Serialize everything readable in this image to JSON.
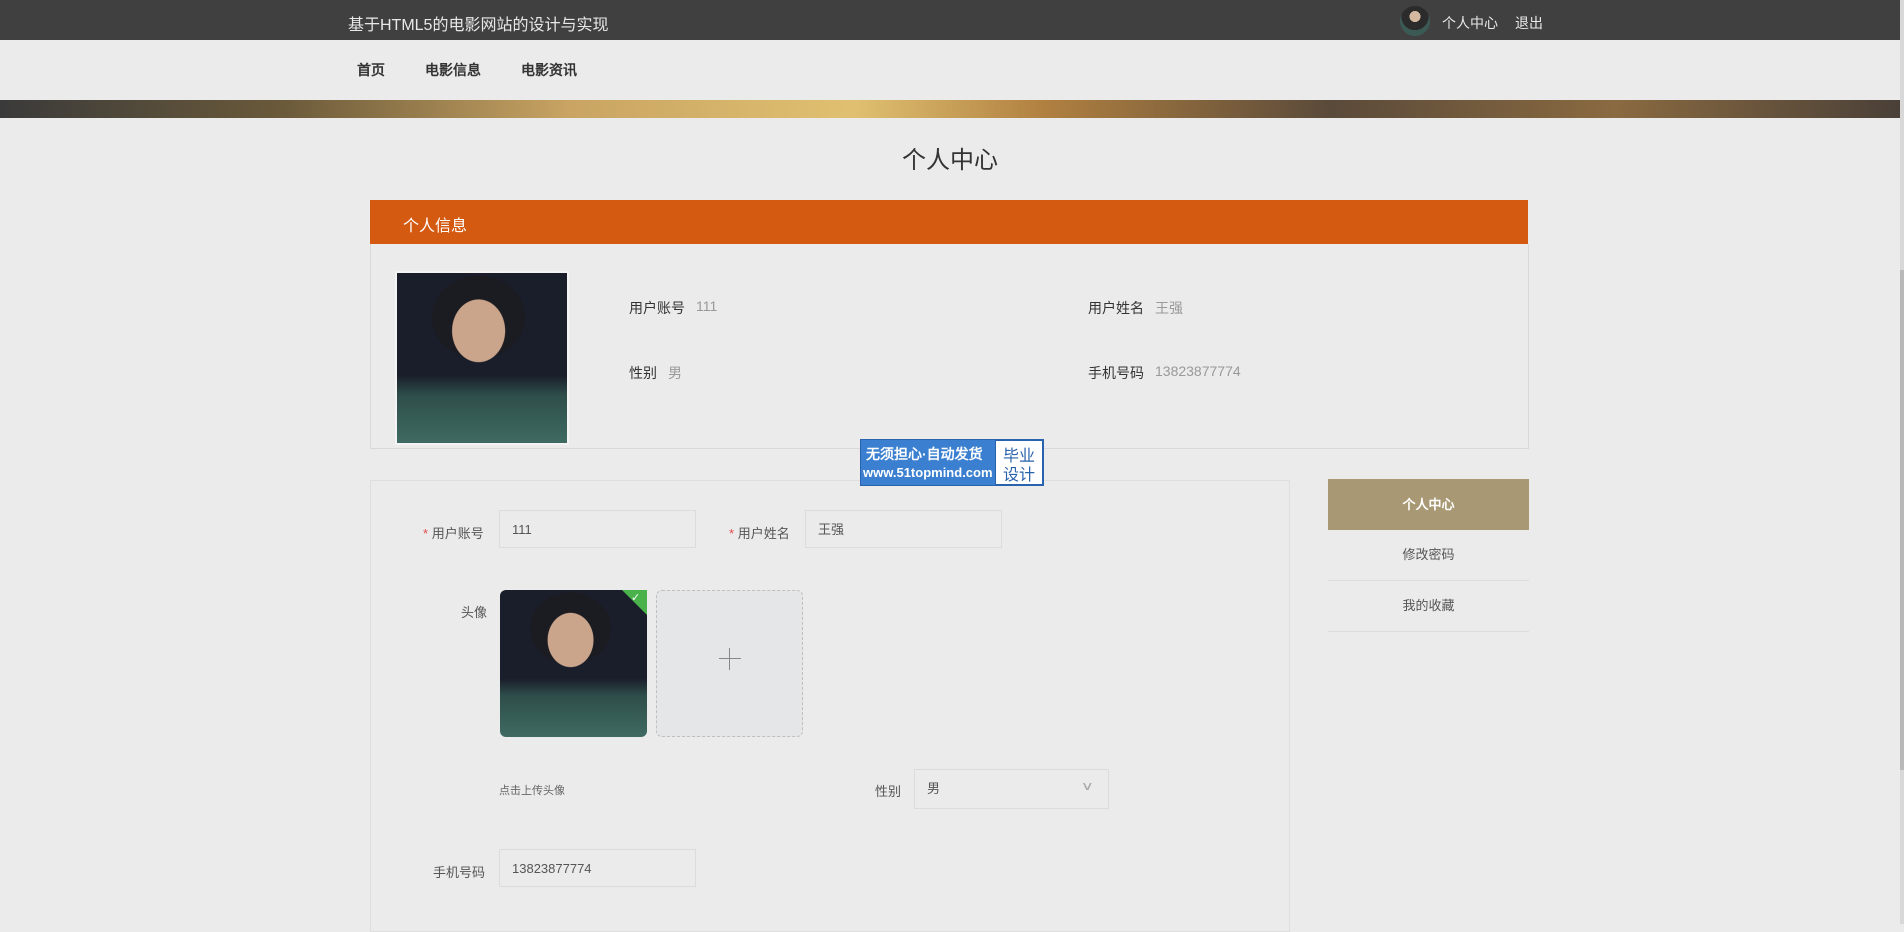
{
  "header": {
    "site_title": "基于HTML5的电影网站的设计与实现",
    "personal_center": "个人中心",
    "logout": "退出"
  },
  "nav": {
    "items": [
      "首页",
      "电影信息",
      "电影资讯"
    ]
  },
  "page": {
    "title": "个人中心"
  },
  "info": {
    "panel_title": "个人信息",
    "account_label": "用户账号",
    "account_value": "111",
    "name_label": "用户姓名",
    "name_value": "王强",
    "gender_label": "性别",
    "gender_value": "男",
    "phone_label": "手机号码",
    "phone_value": "13823877774"
  },
  "watermark": {
    "line1": "无须担心·自动发货",
    "line2": "www.51topmind.com",
    "box_line1": "毕业",
    "box_line2": "设计"
  },
  "form": {
    "required_mark": "*",
    "account_label": "用户账号",
    "account_value": "111",
    "name_label": "用户姓名",
    "name_value": "王强",
    "avatar_label": "头像",
    "upload_hint": "点击上传头像",
    "gender_label": "性别",
    "gender_value": "男",
    "phone_label": "手机号码",
    "phone_value": "13823877774"
  },
  "sidebar": {
    "items": [
      "个人中心",
      "修改密码",
      "我的收藏"
    ]
  },
  "colors": {
    "topbar": "#404040",
    "panel_header": "#d35a10",
    "menu_active": "#a99874",
    "watermark": "#3a7fd0"
  },
  "icons": {
    "upload_add": "plus-icon",
    "upload_done": "check-icon",
    "select": "chevron-down-icon"
  }
}
